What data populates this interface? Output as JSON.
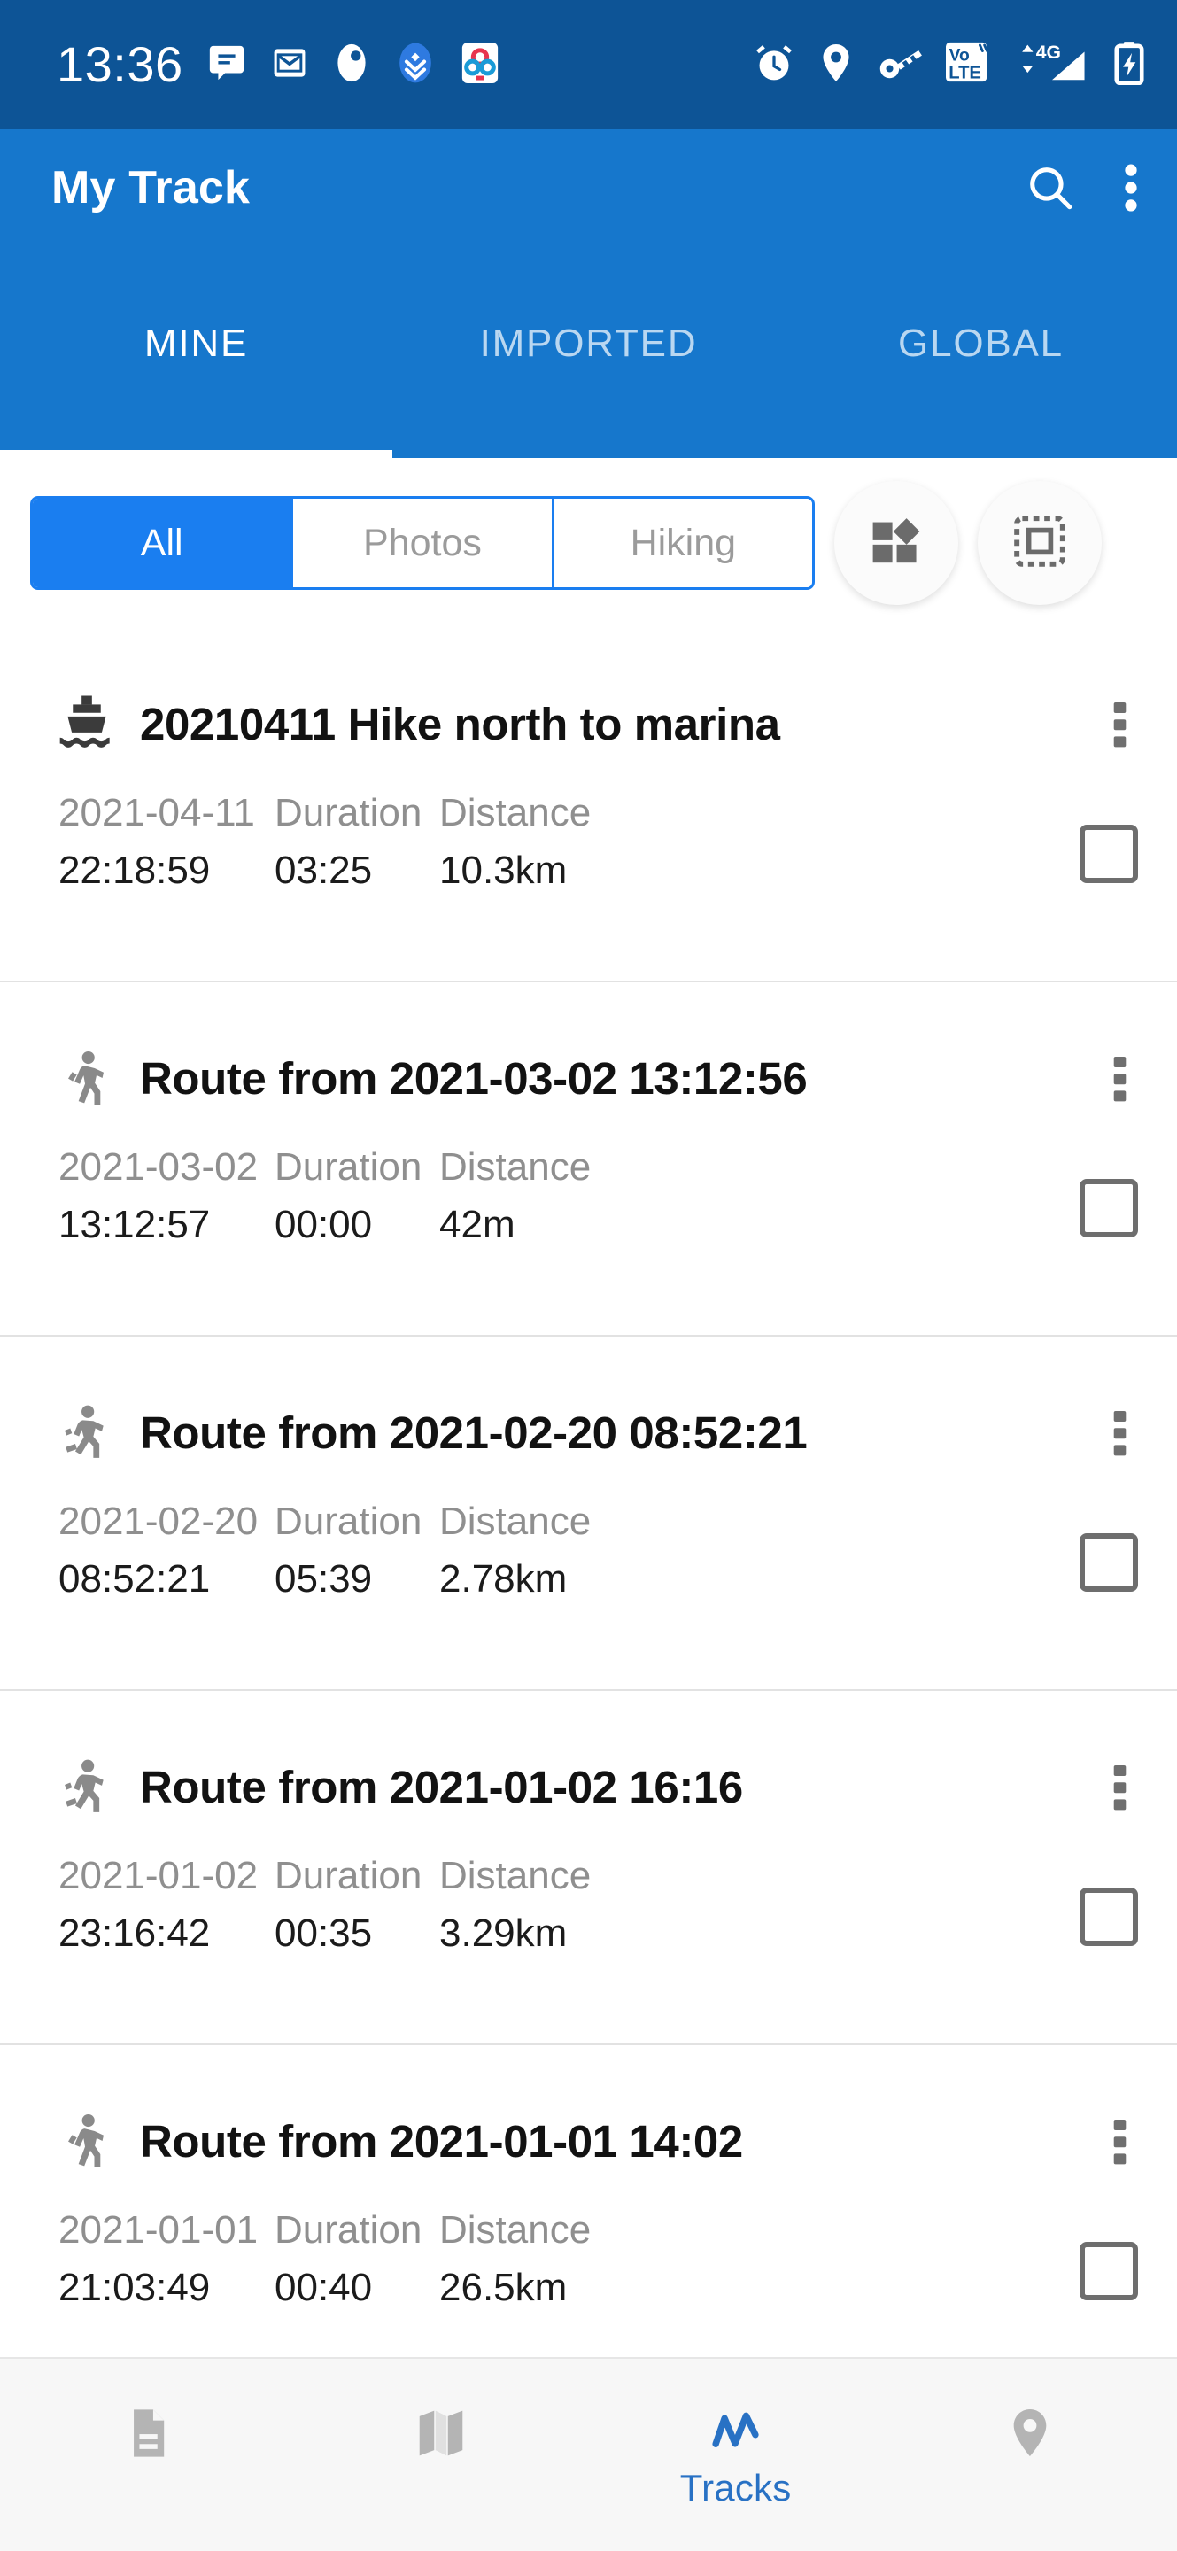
{
  "status_bar": {
    "time": "13:36",
    "left_icons": [
      "chat-bubble-icon",
      "email-icon",
      "app-badge-icon",
      "download-chevrons-icon",
      "molecule-app-icon"
    ],
    "right_icons": [
      "alarm-clock-icon",
      "location-pin-icon",
      "vpn-key-icon",
      "volte-icon",
      "signal-4g-icon",
      "battery-charging-icon"
    ],
    "volte_top": "Vo",
    "volte_bottom": "LTE",
    "network": "4G",
    "background": "#0d5496"
  },
  "app_bar": {
    "title": "My Track",
    "background": "#1677cc",
    "search_icon": "search-icon",
    "overflow_icon": "more-vertical-icon"
  },
  "tabs": {
    "items": [
      {
        "label": "MINE",
        "active": true
      },
      {
        "label": "IMPORTED",
        "active": false
      },
      {
        "label": "GLOBAL",
        "active": false
      }
    ],
    "active_color": "#ffffff",
    "inactive_color": "#b9d7f1"
  },
  "filter": {
    "segments": [
      {
        "label": "All",
        "active": true
      },
      {
        "label": "Photos",
        "active": false
      },
      {
        "label": "Hiking",
        "active": false
      }
    ],
    "accent": "#1a7ef0",
    "buttons": [
      {
        "icon": "dashboard-widgets-icon"
      },
      {
        "icon": "select-all-dashed-icon"
      }
    ]
  },
  "list": {
    "stat_labels": {
      "duration": "Duration",
      "distance": "Distance"
    },
    "items": [
      {
        "icon": "ferry-boat-icon",
        "title": "20210411 Hike north to marina",
        "date": "2021-04-11",
        "time": "22:18:59",
        "duration": "03:25",
        "distance": "10.3km",
        "checked": false
      },
      {
        "icon": "walking-person-icon",
        "title": "Route from 2021-03-02 13:12:56",
        "date": "2021-03-02",
        "time": "13:12:57",
        "duration": "00:00",
        "distance": "42m",
        "checked": false
      },
      {
        "icon": "running-person-icon",
        "title": "Route from 2021-02-20 08:52:21",
        "date": "2021-02-20",
        "time": "08:52:21",
        "duration": "05:39",
        "distance": "2.78km",
        "checked": false
      },
      {
        "icon": "running-person-icon",
        "title": "Route from 2021-01-02 16:16",
        "date": "2021-01-02",
        "time": "23:16:42",
        "duration": "00:35",
        "distance": "3.29km",
        "checked": false
      },
      {
        "icon": "walking-person-icon",
        "title": "Route from 2021-01-01 14:02",
        "date": "2021-01-01",
        "time": "21:03:49",
        "duration": "00:40",
        "distance": "26.5km",
        "checked": false
      }
    ]
  },
  "bottom_nav": {
    "active_color": "#2871c4",
    "inactive_color": "#b4b4b4",
    "items": [
      {
        "icon": "document-icon",
        "label": "",
        "active": false
      },
      {
        "icon": "map-icon",
        "label": "",
        "active": false
      },
      {
        "icon": "tracks-line-icon",
        "label": "Tracks",
        "active": true
      },
      {
        "icon": "location-pin-icon",
        "label": "",
        "active": false
      }
    ]
  }
}
